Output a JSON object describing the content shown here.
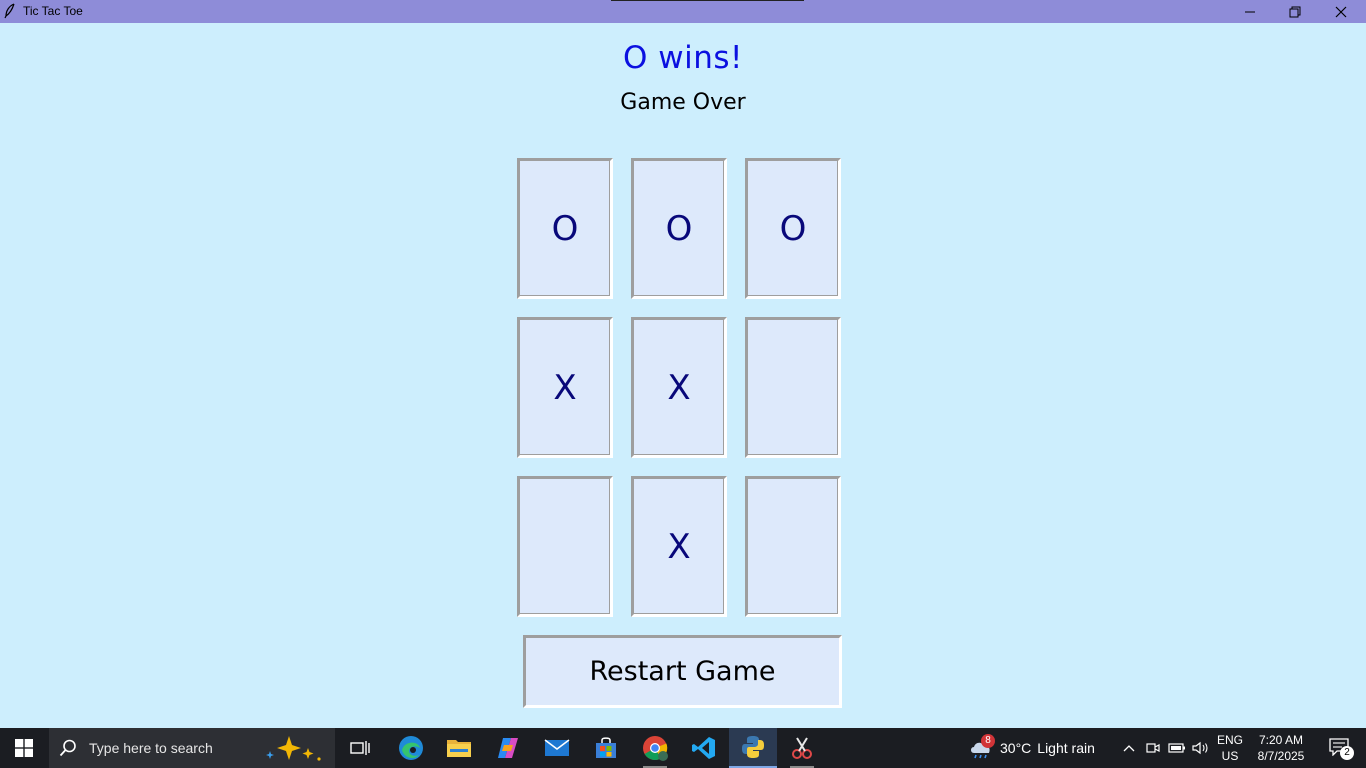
{
  "window": {
    "title": "Tic Tac Toe",
    "titlebar_color": "#8e8cd8"
  },
  "game": {
    "status": "O wins!",
    "substatus": "Game Over",
    "board": [
      [
        "O",
        "O",
        "O"
      ],
      [
        "X",
        "X",
        ""
      ],
      [
        "",
        "X",
        ""
      ]
    ],
    "restart_label": "Restart Game",
    "colors": {
      "background": "#cdeefd",
      "cell": "#dde9fb",
      "mark": "#08087a",
      "status": "#0b10e0"
    }
  },
  "taskbar": {
    "search_placeholder": "Type here to search",
    "pinned_apps": [
      "task-view-icon",
      "edge-icon",
      "file-explorer-icon",
      "copilot-icon",
      "mail-icon",
      "store-icon",
      "chrome-icon",
      "vscode-icon",
      "python-icon",
      "snipping-tool-icon"
    ],
    "weather": {
      "alert_count": "8",
      "temperature": "30°C",
      "condition": "Light rain"
    },
    "language": {
      "line1": "ENG",
      "line2": "US"
    },
    "clock": {
      "time": "7:20 AM",
      "date": "8/7/2025"
    },
    "notification_count": "2"
  }
}
